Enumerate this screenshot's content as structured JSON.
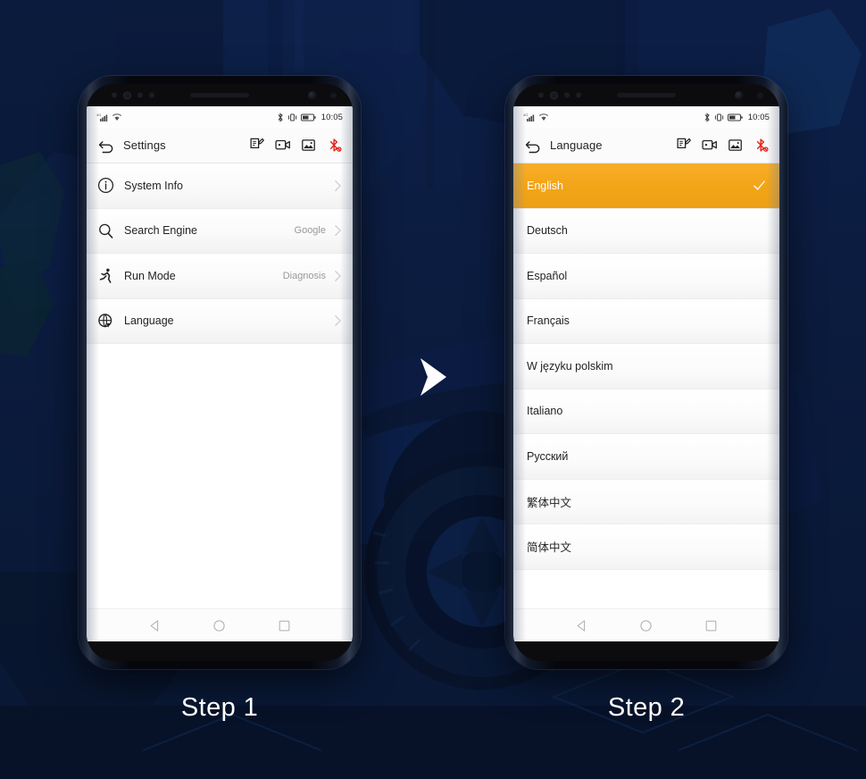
{
  "background": {
    "color": "#0b1b3d",
    "artwork": "posterized-dark-blue-car-wheel"
  },
  "accent_color": "#f3a417",
  "arrow_icon": "chevron-right-icon",
  "phones": [
    {
      "id": "phone-1",
      "caption": "Step 1",
      "status_bar": {
        "signal_icon": "signal-bars-icon",
        "wifi_icon": "wifi-icon",
        "bluetooth_icon": "bluetooth-icon",
        "vibrate_icon": "vibrate-icon",
        "battery_icon": "battery-icon",
        "time": "10:05"
      },
      "app_bar": {
        "back_icon": "back-arrow-icon",
        "title": "Settings",
        "actions": [
          {
            "name": "note-icon",
            "label": "Note"
          },
          {
            "name": "video-camera-icon",
            "label": "Record video"
          },
          {
            "name": "screenshot-icon",
            "label": "Screenshot"
          },
          {
            "name": "bluetooth-off-icon",
            "label": "Bluetooth disconnected"
          }
        ]
      },
      "settings_rows": [
        {
          "icon": "info-circle-icon",
          "label": "System Info",
          "value": "",
          "chevron": true
        },
        {
          "icon": "search-icon",
          "label": "Search Engine",
          "value": "Google",
          "chevron": true
        },
        {
          "icon": "run-mode-icon",
          "label": "Run Mode",
          "value": "Diagnosis",
          "chevron": true
        },
        {
          "icon": "globe-icon",
          "label": "Language",
          "value": "",
          "chevron": true
        }
      ],
      "nav_bar": {
        "back": "nav-back-triangle-icon",
        "home": "nav-home-circle-icon",
        "recents": "nav-recents-square-icon"
      }
    },
    {
      "id": "phone-2",
      "caption": "Step 2",
      "status_bar": {
        "signal_icon": "signal-bars-icon",
        "wifi_icon": "wifi-icon",
        "bluetooth_icon": "bluetooth-icon",
        "vibrate_icon": "vibrate-icon",
        "battery_icon": "battery-icon",
        "time": "10:05"
      },
      "app_bar": {
        "back_icon": "back-arrow-icon",
        "title": "Language",
        "actions": [
          {
            "name": "note-icon",
            "label": "Note"
          },
          {
            "name": "video-camera-icon",
            "label": "Record video"
          },
          {
            "name": "screenshot-icon",
            "label": "Screenshot"
          },
          {
            "name": "bluetooth-off-icon",
            "label": "Bluetooth disconnected"
          }
        ]
      },
      "languages": [
        {
          "label": "English",
          "selected": true
        },
        {
          "label": "Deutsch",
          "selected": false
        },
        {
          "label": "Español",
          "selected": false
        },
        {
          "label": "Français",
          "selected": false
        },
        {
          "label": "W języku polskim",
          "selected": false
        },
        {
          "label": "Italiano",
          "selected": false
        },
        {
          "label": "Русский",
          "selected": false
        },
        {
          "label": "繁体中文",
          "selected": false
        },
        {
          "label": "简体中文",
          "selected": false
        }
      ],
      "nav_bar": {
        "back": "nav-back-triangle-icon",
        "home": "nav-home-circle-icon",
        "recents": "nav-recents-square-icon"
      }
    }
  ]
}
